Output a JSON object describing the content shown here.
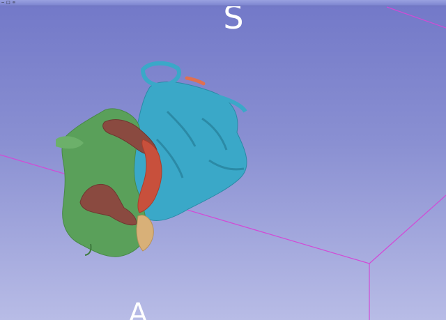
{
  "window": {
    "pin_icon": "pin-icon",
    "maximize_icon": "maximize-icon",
    "link_icon": "link-icon"
  },
  "view": {
    "superior_label": "S",
    "anterior_label": "A",
    "bounding_box_color": "#d24ad6"
  },
  "segments": [
    {
      "name": "left-atrium-blue",
      "color": "#3aa8c8"
    },
    {
      "name": "ventricle-green",
      "color": "#5aa05a"
    },
    {
      "name": "vessel-red",
      "color": "#c8503c"
    },
    {
      "name": "structure-brown",
      "color": "#8a4a40"
    },
    {
      "name": "valve-tan",
      "color": "#d8b078"
    },
    {
      "name": "small-orange",
      "color": "#e07050"
    }
  ]
}
